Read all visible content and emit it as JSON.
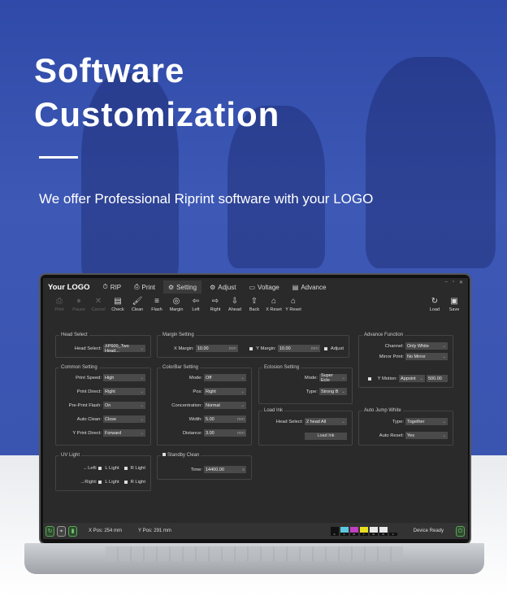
{
  "hero": {
    "title_line1": "Software",
    "title_line2": "Customization",
    "subtitle": "We offer Professional Riprint software with your LOGO"
  },
  "app": {
    "logo": "Your LOGO",
    "tabs": [
      {
        "icon": "⏱",
        "label": "RIP"
      },
      {
        "icon": "⎙",
        "label": "Print"
      },
      {
        "icon": "⚙",
        "label": "Setting",
        "active": true
      },
      {
        "icon": "⚙",
        "label": "Adjust"
      },
      {
        "icon": "▭",
        "label": "Voltage"
      },
      {
        "icon": "▤",
        "label": "Advance"
      }
    ],
    "window_controls": [
      "–",
      "▫",
      "✕"
    ],
    "toolbar": [
      {
        "icon": "⎙",
        "label": "Print",
        "disabled": true
      },
      {
        "icon": "⏸",
        "label": "Pause",
        "disabled": true
      },
      {
        "icon": "✕",
        "label": "Cancel",
        "disabled": true
      },
      {
        "icon": "▤",
        "label": "Check"
      },
      {
        "icon": "🖌",
        "label": "Clean"
      },
      {
        "icon": "≡",
        "label": "Flash"
      },
      {
        "icon": "◎",
        "label": "Margin"
      },
      {
        "icon": "⇦",
        "label": "Left"
      },
      {
        "icon": "⇨",
        "label": "Right"
      },
      {
        "icon": "⇩",
        "label": "Ahead"
      },
      {
        "icon": "⇧",
        "label": "Back"
      },
      {
        "icon": "⌂",
        "label": "X Reset"
      },
      {
        "icon": "⌂",
        "label": "Y Reset"
      }
    ],
    "toolbar_right": [
      {
        "icon": "↻",
        "label": "Load"
      },
      {
        "icon": "▣",
        "label": "Save"
      }
    ],
    "panels": {
      "head": {
        "title": "Head Select",
        "rows": [
          {
            "label": "Head Select:",
            "value": "XP600_Two Head..."
          }
        ]
      },
      "margin": {
        "title": "Margin Setting",
        "x_label": "X Margin:",
        "x_value": "10.00",
        "x_unit": "mm",
        "y_label": "Y Margin:",
        "y_value": "10.00",
        "y_unit": "mm",
        "adjust": "Adjust"
      },
      "advance": {
        "title": "Advance Function",
        "rows": [
          {
            "label": "Channel:",
            "value": "Only White"
          },
          {
            "label": "Mirror Print:",
            "value": "No Mirror"
          }
        ],
        "ymotion_label": "Y Motion:",
        "ymotion_mode": "Appoint",
        "ymotion_value": "500.00"
      },
      "common": {
        "title": "Common Setting",
        "rows": [
          {
            "label": "Print Speed:",
            "value": "High"
          },
          {
            "label": "Print Direct:",
            "value": "Right"
          },
          {
            "label": "Pre-Print Flash:",
            "value": "On"
          },
          {
            "label": "Auto Clean:",
            "value": "Close"
          },
          {
            "label": "Y Print Direct:",
            "value": "Forward"
          }
        ]
      },
      "colorbar": {
        "title": "ColorBar Setting",
        "rows": [
          {
            "label": "Mode:",
            "value": "Off"
          },
          {
            "label": "Pos:",
            "value": "Right"
          },
          {
            "label": "Concentration:",
            "value": "Normal"
          },
          {
            "label": "Width:",
            "value": "5.00",
            "unit": "mm"
          },
          {
            "label": "Distance:",
            "value": "3.00",
            "unit": "mm"
          }
        ]
      },
      "eclosion": {
        "title": "Eclosion Setting",
        "rows": [
          {
            "label": "Mode:",
            "value": "Super Eclo"
          },
          {
            "label": "Type:",
            "value": "Strong B"
          }
        ]
      },
      "loadink": {
        "title": "Load Ink",
        "rows": [
          {
            "label": "Head Select:",
            "value": "2 head All"
          }
        ],
        "button": "Load Ink"
      },
      "autojump": {
        "title": "Auto Jump White",
        "rows": [
          {
            "label": "Type:",
            "value": "Together"
          },
          {
            "label": "Auto Reset:",
            "value": "Yes"
          }
        ]
      },
      "uv": {
        "title": "UV Light",
        "left": "←Left:",
        "right": "→Right:",
        "l": "L Light",
        "r": "R Light"
      },
      "standby": {
        "title": "Standby Clean",
        "time_label": "Time:",
        "time_value": "14400.00",
        "unit": "s"
      }
    },
    "status": {
      "xpos": "X Pos: 254 mm",
      "ypos": "Y Pos: 291 mm",
      "device": "Device Ready",
      "inks": [
        {
          "color": "#111111",
          "label": "K"
        },
        {
          "color": "#5bc8e0",
          "label": "C"
        },
        {
          "color": "#c040c0",
          "label": "M"
        },
        {
          "color": "#e8e020",
          "label": "Y"
        },
        {
          "color": "#e8e8e8",
          "label": "W"
        },
        {
          "color": "#e8e8e8",
          "label": "W"
        },
        {
          "color": "#333333",
          "label": "V"
        }
      ]
    }
  }
}
